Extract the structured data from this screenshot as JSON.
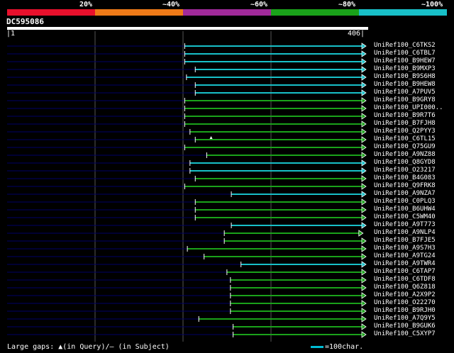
{
  "legend": {
    "labels": [
      "20%",
      "~40%",
      "~60%",
      "~80%",
      "~100%"
    ],
    "colors": [
      "#e8102c",
      "#ee7a18",
      "#a02a9a",
      "#1aa21a",
      "#18c0c8"
    ]
  },
  "query": {
    "id": "DC595086",
    "start": "|1",
    "end": "406|",
    "length": 406
  },
  "footer": {
    "gaps_text": "Large gaps: ▲(in Query)/― (in Subject)",
    "scale_text": "=100char."
  },
  "colors": {
    "query_line": "#000066",
    "identity_80": "#1aa21a",
    "identity_100": "#18c0c8",
    "grid": "#555555"
  },
  "hits": [
    {
      "name": "UniRef100_C6TKS2",
      "start": 203,
      "color": "cyan"
    },
    {
      "name": "UniRef100_C6TBL7",
      "start": 203,
      "color": "cyan"
    },
    {
      "name": "UniRef100_B9HEW7",
      "start": 203,
      "color": "cyan"
    },
    {
      "name": "UniRef100_B9MXP3",
      "start": 215,
      "color": "cyan"
    },
    {
      "name": "UniRef100_B9S6H8",
      "start": 205,
      "color": "cyan"
    },
    {
      "name": "UniRef100_B9HEW8",
      "start": 215,
      "color": "cyan"
    },
    {
      "name": "UniRef100_A7PUV5",
      "start": 215,
      "color": "cyan"
    },
    {
      "name": "UniRef100_B9GRY8",
      "start": 203,
      "color": "green"
    },
    {
      "name": "UniRef100_UPI000..",
      "start": 203,
      "color": "green"
    },
    {
      "name": "UniRef100_B9R7T6",
      "start": 203,
      "color": "green"
    },
    {
      "name": "UniRef100_B7FJH8",
      "start": 203,
      "color": "green"
    },
    {
      "name": "UniRef100_Q2PYY3",
      "start": 209,
      "color": "green"
    },
    {
      "name": "UniRef100_C6TL15",
      "start": 215,
      "color": "green",
      "gap_at": 233
    },
    {
      "name": "UniRef100_Q75GU9",
      "start": 203,
      "color": "green"
    },
    {
      "name": "UniRef100_A9NZ88",
      "start": 228,
      "color": "green"
    },
    {
      "name": "UniRef100_Q8GYD8",
      "start": 209,
      "color": "cyan"
    },
    {
      "name": "UniRef100_O23217",
      "start": 209,
      "color": "cyan"
    },
    {
      "name": "UniRef100_B4G083",
      "start": 215,
      "color": "green"
    },
    {
      "name": "UniRef100_Q9FRK8",
      "start": 203,
      "color": "green"
    },
    {
      "name": "UniRef100_A9NZA7",
      "start": 256,
      "color": "cyan"
    },
    {
      "name": "UniRef100_C0PLQ3",
      "start": 215,
      "color": "green"
    },
    {
      "name": "UniRef100_B6UHW4",
      "start": 215,
      "color": "green"
    },
    {
      "name": "UniRef100_C5WM40",
      "start": 215,
      "color": "green"
    },
    {
      "name": "UniRef100_A9T773",
      "start": 256,
      "color": "cyan"
    },
    {
      "name": "UniRef100_A9NLP4",
      "start": 248,
      "color": "green",
      "end": 401
    },
    {
      "name": "UniRef100_B7FJE5",
      "start": 248,
      "color": "green"
    },
    {
      "name": "UniRef100_A9S7H3",
      "start": 206,
      "color": "green"
    },
    {
      "name": "UniRef100_A9TG24",
      "start": 225,
      "color": "green"
    },
    {
      "name": "UniRef100_A9TWR4",
      "start": 267,
      "color": "cyan"
    },
    {
      "name": "UniRef100_C6TAP7",
      "start": 251,
      "color": "green"
    },
    {
      "name": "UniRef100_C6TDF8",
      "start": 255,
      "color": "green"
    },
    {
      "name": "UniRef100_Q6Z818",
      "start": 255,
      "color": "green"
    },
    {
      "name": "UniRef100_A2X9P2",
      "start": 255,
      "color": "green"
    },
    {
      "name": "UniRef100_O22270",
      "start": 255,
      "color": "green"
    },
    {
      "name": "UniRef100_B9RJH0",
      "start": 255,
      "color": "green"
    },
    {
      "name": "UniRef100_A7Q9Y5",
      "start": 219,
      "color": "green"
    },
    {
      "name": "UniRef100_B9GUK6",
      "start": 258,
      "color": "green"
    },
    {
      "name": "UniRef100_C5XYP7",
      "start": 258,
      "color": "green"
    }
  ]
}
